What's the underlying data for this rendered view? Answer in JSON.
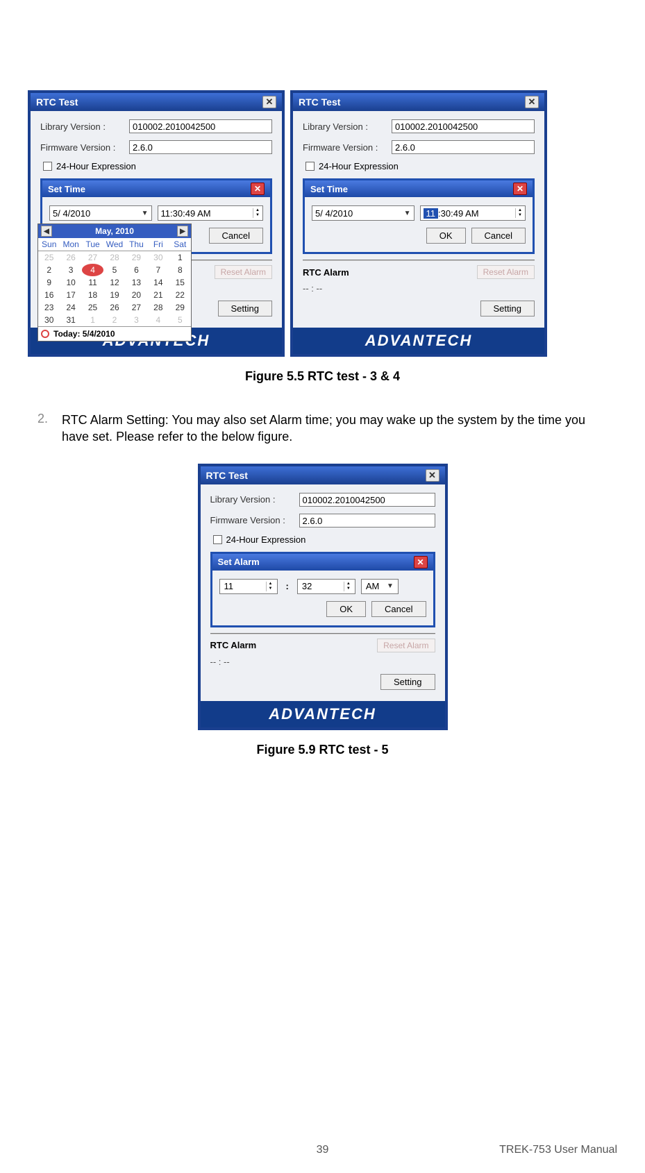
{
  "common": {
    "windowTitle": "RTC Test",
    "labels": {
      "libraryVersion": "Library Version :",
      "firmwareVersion": "Firmware Version :",
      "hour24": "24-Hour Expression",
      "rtcAlarm": "RTC Alarm",
      "resetAlarm": "Reset Alarm",
      "setting": "Setting",
      "ok": "OK",
      "cancel": "Cancel"
    },
    "values": {
      "libraryVersion": "010002.2010042500",
      "firmwareVersion": "2.6.0",
      "alarmTime": "-- : --"
    },
    "logo": "ADVANTECH"
  },
  "fig1": {
    "innerTitle": "Set Time",
    "date": "5/  4/2010",
    "time": "11:30:49 AM",
    "calendar": {
      "monthLabel": "May, 2010",
      "dow": [
        "Sun",
        "Mon",
        "Tue",
        "Wed",
        "Thu",
        "Fri",
        "Sat"
      ],
      "rows": [
        [
          {
            "d": "25",
            "o": true
          },
          {
            "d": "26",
            "o": true
          },
          {
            "d": "27",
            "o": true
          },
          {
            "d": "28",
            "o": true
          },
          {
            "d": "29",
            "o": true
          },
          {
            "d": "30",
            "o": true
          },
          {
            "d": "1"
          }
        ],
        [
          {
            "d": "2"
          },
          {
            "d": "3"
          },
          {
            "d": "4",
            "sel": true
          },
          {
            "d": "5"
          },
          {
            "d": "6"
          },
          {
            "d": "7"
          },
          {
            "d": "8"
          }
        ],
        [
          {
            "d": "9"
          },
          {
            "d": "10"
          },
          {
            "d": "11"
          },
          {
            "d": "12"
          },
          {
            "d": "13"
          },
          {
            "d": "14"
          },
          {
            "d": "15"
          }
        ],
        [
          {
            "d": "16"
          },
          {
            "d": "17"
          },
          {
            "d": "18"
          },
          {
            "d": "19"
          },
          {
            "d": "20"
          },
          {
            "d": "21"
          },
          {
            "d": "22"
          }
        ],
        [
          {
            "d": "23"
          },
          {
            "d": "24"
          },
          {
            "d": "25"
          },
          {
            "d": "26"
          },
          {
            "d": "27"
          },
          {
            "d": "28"
          },
          {
            "d": "29"
          }
        ],
        [
          {
            "d": "30"
          },
          {
            "d": "31"
          },
          {
            "d": "1",
            "o": true
          },
          {
            "d": "2",
            "o": true
          },
          {
            "d": "3",
            "o": true
          },
          {
            "d": "4",
            "o": true
          },
          {
            "d": "5",
            "o": true
          }
        ]
      ],
      "today": "Today: 5/4/2010"
    }
  },
  "fig2": {
    "innerTitle": "Set Time",
    "date": "5/  4/2010",
    "timeHighlighted": "11",
    "timeRest": ":30:49 AM"
  },
  "fig3": {
    "innerTitle": "Set Alarm",
    "hour": "11",
    "minute": "32",
    "ampm": "AM"
  },
  "captions": {
    "fig55": "Figure 5.5 RTC test - 3 & 4",
    "fig59": "Figure 5.9 RTC test - 5"
  },
  "step": {
    "num": "2.",
    "text": "RTC Alarm Setting: You may also set Alarm time; you may wake up the system by the time you have set. Please refer to the below figure."
  },
  "footer": {
    "page": "39",
    "manual": "TREK-753 User Manual"
  }
}
